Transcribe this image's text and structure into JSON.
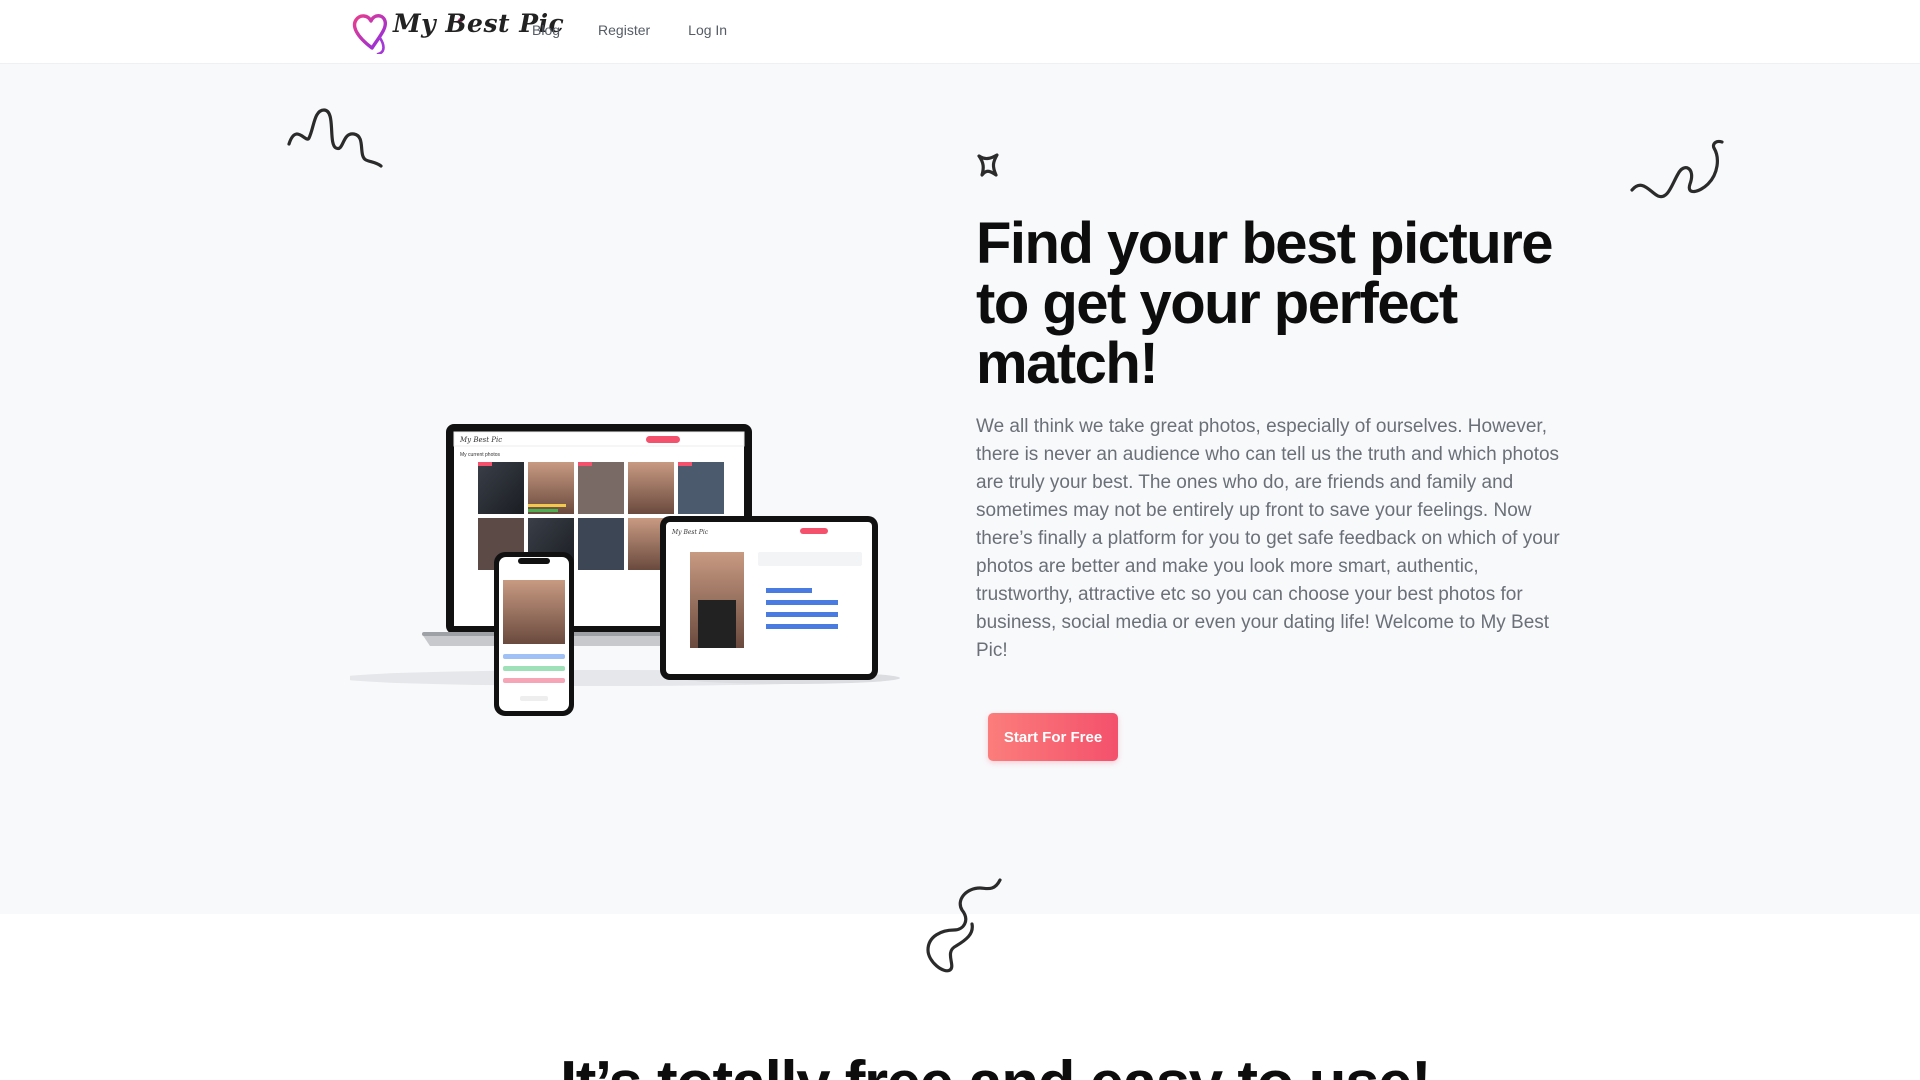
{
  "header": {
    "logo_text": "My Best Pic",
    "nav": [
      {
        "label": "Blog"
      },
      {
        "label": "Register"
      },
      {
        "label": "Log In"
      }
    ]
  },
  "hero": {
    "headline": "Find your best picture to get your perfect match!",
    "description": "We all think we take great photos, especially of ourselves. However, there is never an audience who can tell us the truth and which photos are truly your best. The ones who do, are friends and family and sometimes may not be entirely up front to save your feelings. Now there’s finally a platform for you to get safe feedback on which of your photos are better and make you look more smart, authentic, trustworthy, attractive etc so you can choose your best photos for business, social media or even your dating life! Welcome to My Best Pic!",
    "cta_label": "Start For Free",
    "device_mockup": "laptop-tablet-phone-mockup"
  },
  "next_section": {
    "title": "It’s totally free and easy to use!"
  },
  "colors": {
    "accent_start": "#fb7d7b",
    "accent_end": "#f4516c",
    "hero_bg": "#f8f9fb",
    "heading": "#0d0d0d",
    "body_text": "#6b7078"
  }
}
